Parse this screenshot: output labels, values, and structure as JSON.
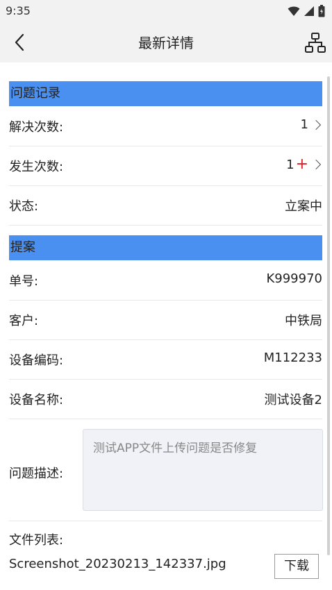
{
  "status_bar": {
    "time": "9:35"
  },
  "nav": {
    "title": "最新详情"
  },
  "sections": {
    "problem_record": "问题记录",
    "proposal": "提案"
  },
  "problem": {
    "resolve_count_label": "解决次数:",
    "resolve_count_value": "1",
    "occur_count_label": "发生次数:",
    "occur_count_value": "1",
    "status_label": "状态:",
    "status_value": "立案中"
  },
  "proposal": {
    "number_label": "单号:",
    "number_value": "K999970",
    "customer_label": "客户:",
    "customer_value": "中铁局",
    "device_code_label": "设备编码:",
    "device_code_value": "M112233",
    "device_name_label": "设备名称:",
    "device_name_value": "测试设备2",
    "description_label": "问题描述:",
    "description_value": "测试APP文件上传问题是否修复"
  },
  "files": {
    "label": "文件列表:",
    "items": [
      {
        "name": "Screenshot_20230213_142337.jpg",
        "download_label": "下载"
      }
    ]
  },
  "icons": {
    "back": "chevron-left-icon",
    "tree": "hierarchy-icon",
    "wifi": "wifi-icon",
    "signal": "signal-icon",
    "battery": "battery-icon",
    "chevron": "chevron-right-icon",
    "add": "plus-icon"
  },
  "colors": {
    "section_header": "#4a90f0",
    "plus": "#e02020",
    "bar_bg": "#f2f2f2"
  }
}
